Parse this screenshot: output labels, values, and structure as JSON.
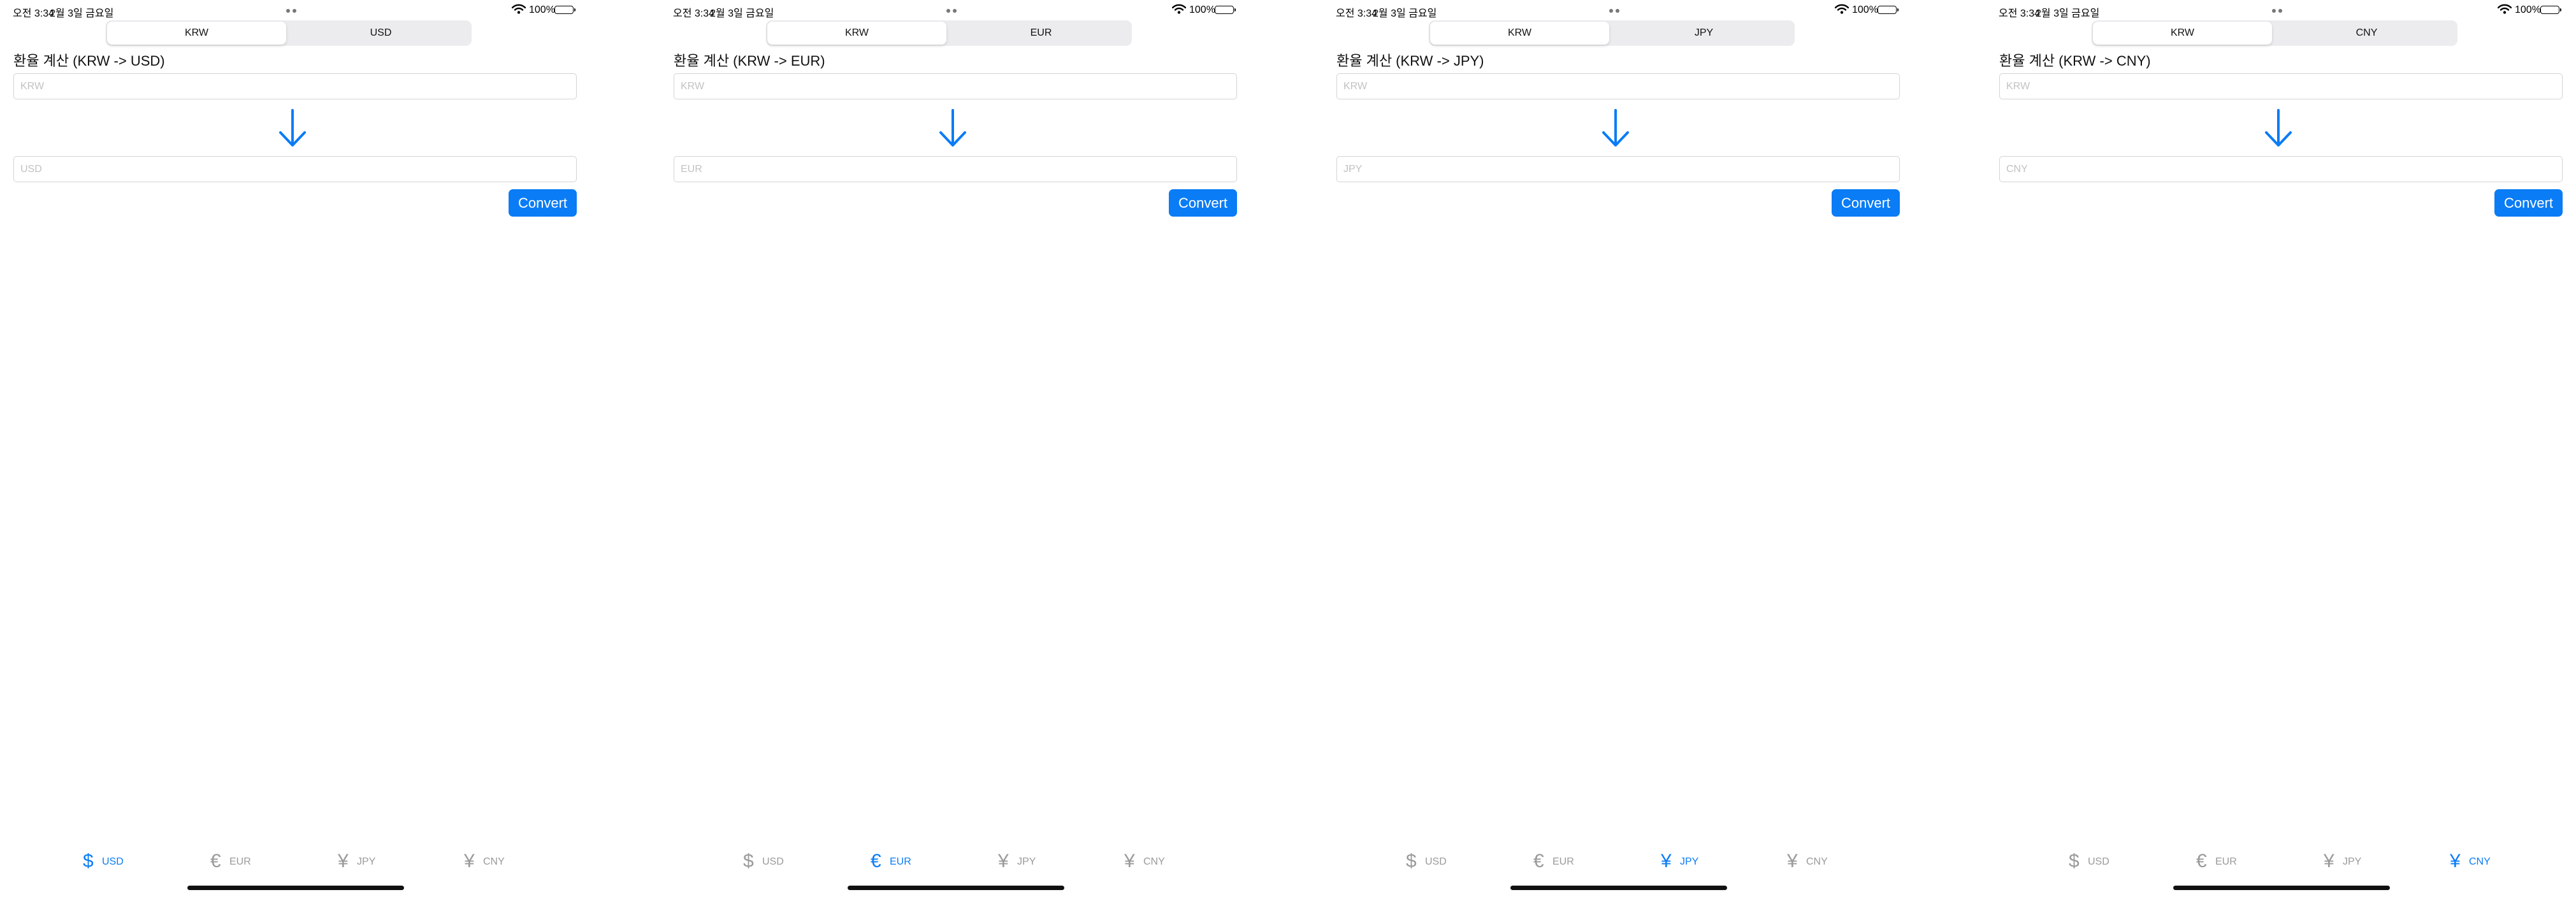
{
  "colors": {
    "accent": "#0a7cf5",
    "inactive_tab": "#9a9a9a",
    "segment_bg": "#ececef"
  },
  "icons": {
    "arrow": "arrow-down-icon",
    "wifi": "wifi-icon",
    "battery": "battery-icon"
  },
  "screens": [
    {
      "status": {
        "time": "오전 3:34",
        "date": "2월 3일 금요일",
        "battery": "100%"
      },
      "segment": {
        "left": "KRW",
        "right": "USD",
        "selected": "KRW"
      },
      "title": "환율 계산 (KRW -> USD)",
      "from_input": {
        "placeholder": "KRW",
        "value": ""
      },
      "to_input": {
        "placeholder": "USD",
        "value": ""
      },
      "convert_label": "Convert",
      "tabs": [
        {
          "symbol": "$",
          "label": "USD",
          "active": true
        },
        {
          "symbol": "€",
          "label": "EUR",
          "active": false
        },
        {
          "symbol": "¥",
          "label": "JPY",
          "active": false
        },
        {
          "symbol": "¥",
          "label": "CNY",
          "active": false
        }
      ]
    },
    {
      "status": {
        "time": "오전 3:34",
        "date": "2월 3일 금요일",
        "battery": "100%"
      },
      "segment": {
        "left": "KRW",
        "right": "EUR",
        "selected": "KRW"
      },
      "title": "환율 계산 (KRW -> EUR)",
      "from_input": {
        "placeholder": "KRW",
        "value": ""
      },
      "to_input": {
        "placeholder": "EUR",
        "value": ""
      },
      "convert_label": "Convert",
      "tabs": [
        {
          "symbol": "$",
          "label": "USD",
          "active": false
        },
        {
          "symbol": "€",
          "label": "EUR",
          "active": true
        },
        {
          "symbol": "¥",
          "label": "JPY",
          "active": false
        },
        {
          "symbol": "¥",
          "label": "CNY",
          "active": false
        }
      ]
    },
    {
      "status": {
        "time": "오전 3:34",
        "date": "2월 3일 금요일",
        "battery": "100%"
      },
      "segment": {
        "left": "KRW",
        "right": "JPY",
        "selected": "KRW"
      },
      "title": "환율 계산 (KRW -> JPY)",
      "from_input": {
        "placeholder": "KRW",
        "value": ""
      },
      "to_input": {
        "placeholder": "JPY",
        "value": ""
      },
      "convert_label": "Convert",
      "tabs": [
        {
          "symbol": "$",
          "label": "USD",
          "active": false
        },
        {
          "symbol": "€",
          "label": "EUR",
          "active": false
        },
        {
          "symbol": "¥",
          "label": "JPY",
          "active": true
        },
        {
          "symbol": "¥",
          "label": "CNY",
          "active": false
        }
      ]
    },
    {
      "status": {
        "time": "오전 3:34",
        "date": "2월 3일 금요일",
        "battery": "100%"
      },
      "segment": {
        "left": "KRW",
        "right": "CNY",
        "selected": "KRW"
      },
      "title": "환율 계산 (KRW -> CNY)",
      "from_input": {
        "placeholder": "KRW",
        "value": ""
      },
      "to_input": {
        "placeholder": "CNY",
        "value": ""
      },
      "convert_label": "Convert",
      "tabs": [
        {
          "symbol": "$",
          "label": "USD",
          "active": false
        },
        {
          "symbol": "€",
          "label": "EUR",
          "active": false
        },
        {
          "symbol": "¥",
          "label": "JPY",
          "active": false
        },
        {
          "symbol": "¥",
          "label": "CNY",
          "active": true
        }
      ]
    }
  ]
}
